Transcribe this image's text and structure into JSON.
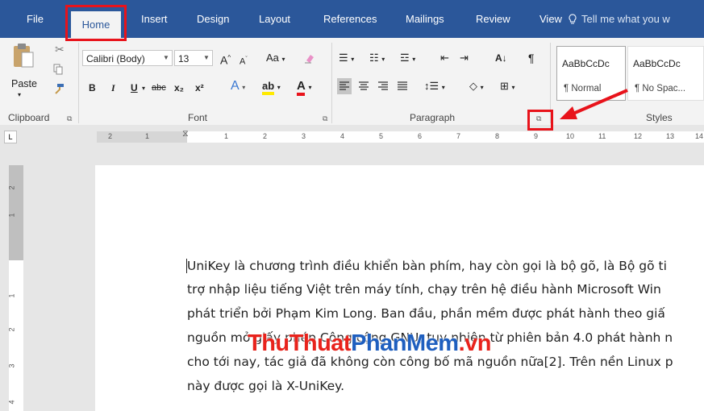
{
  "tabs": {
    "file": "File",
    "home": "Home",
    "insert": "Insert",
    "design": "Design",
    "layout": "Layout",
    "references": "References",
    "mailings": "Mailings",
    "review": "Review",
    "view": "View",
    "tell_me": "Tell me what you w"
  },
  "clipboard": {
    "paste_label": "Paste",
    "group_label": "Clipboard"
  },
  "font": {
    "name": "Calibri (Body)",
    "size": "13",
    "case_label": "Aa",
    "bold": "B",
    "italic": "I",
    "underline": "U",
    "strike": "abc",
    "subscript": "x₂",
    "superscript": "x²",
    "grow": "Aˆ",
    "shrink": "Aˇ",
    "font_color": "A",
    "highlight": "ab",
    "group_label": "Font"
  },
  "paragraph": {
    "group_label": "Paragraph",
    "show_marks": "¶",
    "sort": "A↓"
  },
  "styles": {
    "items": [
      {
        "preview": "AaBbCcDc",
        "name": "¶ Normal"
      },
      {
        "preview": "AaBbCcDc",
        "name": "¶ No Spac..."
      }
    ],
    "group_label": "Styles"
  },
  "ruler": {
    "ticks": [
      "2",
      "1",
      "1",
      "2",
      "3",
      "4",
      "5",
      "6",
      "7",
      "8",
      "9",
      "10",
      "11",
      "12",
      "13",
      "14"
    ]
  },
  "document": {
    "lines": [
      "UniKey là chương trình điều khiển bàn phím, hay còn gọi là bộ gõ, là Bộ gõ ti",
      "trợ nhập liệu tiếng Việt trên máy tính, chạy trên hệ điều hành Microsoft Win",
      "phát triển bởi Phạm Kim Long. Ban đầu, phần mềm được phát hành theo giấ",
      "nguồn mở giấy phép Công cộng GNU, tuy nhiên từ phiên bản 4.0 phát hành n",
      "cho tới nay, tác giả đã không còn công bố mã nguồn nữa[2]. Trên nền Linux p",
      "này được gọi là X-UniKey."
    ]
  },
  "watermark": {
    "part1": "ThuThuat",
    "part2": "PhanMem",
    "part3": ".vn"
  },
  "colors": {
    "ribbon_blue": "#2b579a",
    "highlight_red": "#e8131b",
    "watermark_red": "#e8231c",
    "watermark_blue": "#1f5fbf"
  }
}
